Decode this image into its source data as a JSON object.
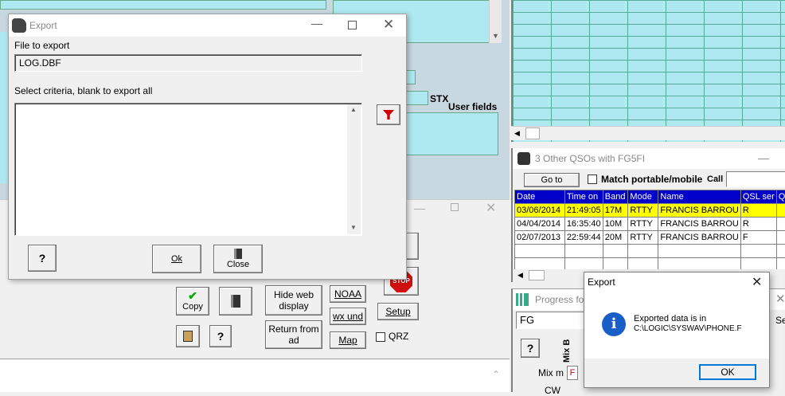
{
  "export_window": {
    "title": "Export",
    "file_label": "File to export",
    "file_value": "LOG.DBF",
    "criteria_label": "Select criteria, blank to export all",
    "ok_label": "Ok",
    "close_label": "Close"
  },
  "background": {
    "stx_label": "STX",
    "user_fields_label": "User fields",
    "copy_label": "Copy",
    "hide_web_label": "Hide web display",
    "return_label": "Return from ad",
    "noaa_label": "NOAA",
    "wx_label": "wx und",
    "map_label": "Map",
    "setup_label": "Setup",
    "qrz_label": "QRZ",
    "stop_label": "STOP"
  },
  "qso_window": {
    "title": "3 Other QSOs with FG5FI",
    "goto_label": "Go to",
    "match_label": "Match portable/mobile",
    "call_label": "Call",
    "columns": [
      "Date",
      "Time on",
      "Band",
      "Mode",
      "Name",
      "QSL ser",
      "QSL"
    ],
    "rows": [
      [
        "03/06/2014",
        "21:49:05",
        "17M",
        "RTTY",
        "FRANCIS BARROU",
        "R",
        ""
      ],
      [
        "04/04/2014",
        "16:35:40",
        "10M",
        "RTTY",
        "FRANCIS BARROU",
        "R",
        ""
      ],
      [
        "02/07/2013",
        "22:59:44",
        "20M",
        "RTTY",
        "FRANCIS BARROU",
        "F",
        ""
      ]
    ],
    "highlight_color": "#ffff00"
  },
  "progress_window": {
    "title": "Progress for",
    "field_value": "FG",
    "side_label": "Se",
    "mix_label": "Mix m",
    "cw_label": "CW",
    "mixb_label": "Mix B",
    "f_label": "F"
  },
  "message_box": {
    "title": "Export",
    "line1": "Exported data is in",
    "line2": "C:\\LOGIC\\SYSWAV\\PHONE.F",
    "ok_label": "OK"
  }
}
